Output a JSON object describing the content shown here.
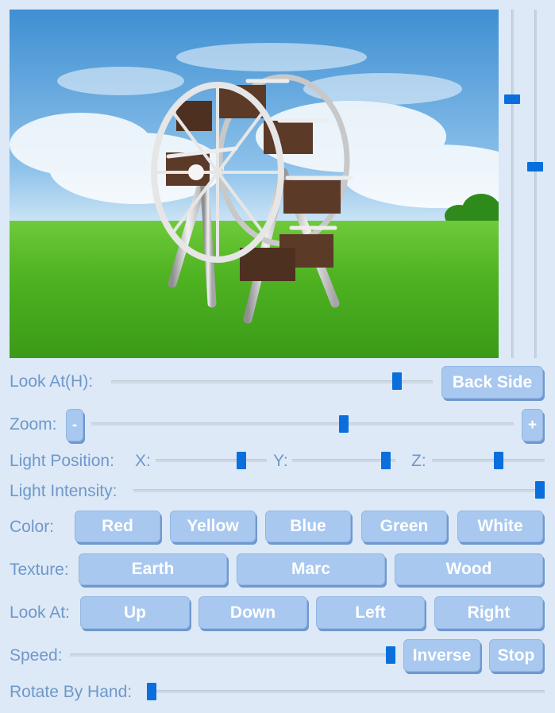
{
  "sliders": {
    "vertical_1": {
      "value": 0.25
    },
    "vertical_2": {
      "value": 0.45
    },
    "look_at_h": {
      "label": "Look At(H):",
      "value": 0.9
    },
    "zoom": {
      "label": "Zoom:",
      "value": 0.6
    },
    "light_x": {
      "label": "X:",
      "value": 0.8
    },
    "light_y": {
      "label": "Y:",
      "value": 0.95
    },
    "light_z": {
      "label": "Z:",
      "value": 0.6
    },
    "light_intensity": {
      "label": "Light Intensity:",
      "value": 1.0
    },
    "speed": {
      "label": "Speed:",
      "value": 1.0
    },
    "rotate_by_hand": {
      "label": "Rotate By Hand:",
      "value": 0.0
    }
  },
  "labels": {
    "light_position": "Light Position:",
    "color": "Color:",
    "texture": "Texture:",
    "look_at": "Look At:"
  },
  "buttons": {
    "back_side": "Back Side",
    "zoom_out": "-",
    "zoom_in": "+",
    "colors": [
      "Red",
      "Yellow",
      "Blue",
      "Green",
      "White"
    ],
    "textures": [
      "Earth",
      "Marc",
      "Wood"
    ],
    "look_at": [
      "Up",
      "Down",
      "Left",
      "Right"
    ],
    "inverse": "Inverse",
    "stop": "Stop"
  },
  "scene": {
    "subject": "ferris-wheel",
    "texture": "wood"
  },
  "colors": {
    "accent": "#0a6fdc",
    "button": "#a8c8ef",
    "text": "#6f98c9",
    "background": "#dde9f7"
  }
}
